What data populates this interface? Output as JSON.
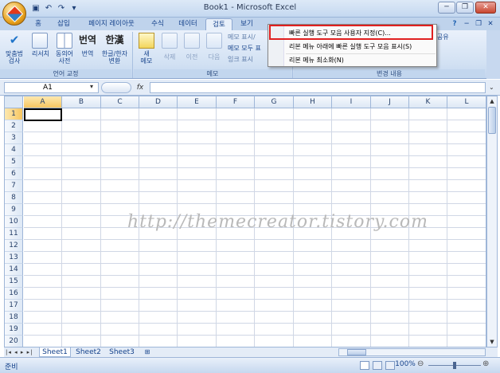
{
  "window": {
    "title": "Book1 - Microsoft Excel",
    "minimize": "─",
    "restore": "❐",
    "close": "✕"
  },
  "qat": {
    "save_icon": "save-icon",
    "undo_icon": "undo-icon",
    "redo_icon": "redo-icon",
    "customize_icon": "dropdown-icon"
  },
  "tabs": [
    {
      "label": "홈"
    },
    {
      "label": "삽입"
    },
    {
      "label": "페이지 레이아웃"
    },
    {
      "label": "수식"
    },
    {
      "label": "데이터"
    },
    {
      "label": "검토",
      "active": true
    },
    {
      "label": "보기"
    }
  ],
  "tab_right": {
    "help": "?",
    "min": "─",
    "restore": "❐",
    "close": "✕"
  },
  "ribbon": {
    "proofing": {
      "label": "언어 교정",
      "buttons": [
        {
          "l1": "맞춤법",
          "l2": "검사"
        },
        {
          "l1": "리서치",
          "l2": ""
        },
        {
          "l1": "동의어",
          "l2": "사전"
        },
        {
          "l1": "번역",
          "l2": ""
        },
        {
          "l1": "한글/한자",
          "l2": "변환"
        }
      ]
    },
    "comments": {
      "label": "메모",
      "new_l1": "새",
      "new_l2": "메모",
      "delete": "삭제",
      "prev": "이전",
      "next": "다음",
      "show": "메모 표시/",
      "show_all": "메모 모두 표",
      "ink": "잉크 표시"
    },
    "changes": {
      "label": "변경 내용",
      "share": "와 공유"
    }
  },
  "formula": {
    "namebox": "A1",
    "fx": "fx"
  },
  "columns": [
    "A",
    "B",
    "C",
    "D",
    "E",
    "F",
    "G",
    "H",
    "I",
    "J",
    "K",
    "L"
  ],
  "rows": [
    "1",
    "2",
    "3",
    "4",
    "5",
    "6",
    "7",
    "8",
    "9",
    "10",
    "11",
    "12",
    "13",
    "14",
    "15",
    "16",
    "17",
    "18",
    "19",
    "20"
  ],
  "sheets": [
    "Sheet1",
    "Sheet2",
    "Sheet3"
  ],
  "status": {
    "ready": "준비",
    "zoom": "100%"
  },
  "watermark": "http://themecreator.tistory.com",
  "menu": {
    "items": [
      "빠른 실행 도구 모음 사용자 지정(C)...",
      "리본 메뉴 아래에 빠른 실행 도구 모음 표시(S)",
      "리본 메뉴 최소화(N)"
    ]
  }
}
